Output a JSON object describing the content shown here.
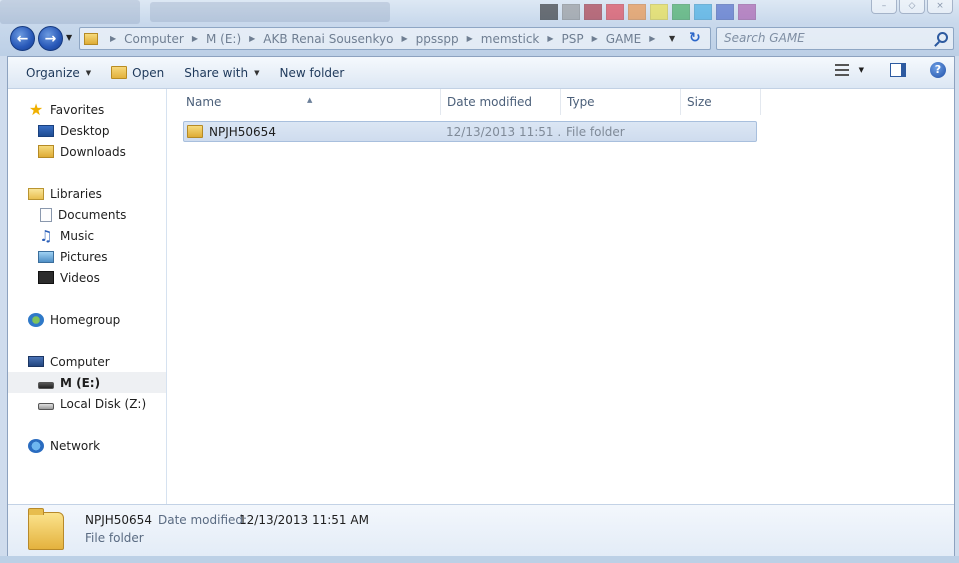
{
  "window": {
    "controls": [
      "–",
      "◇",
      "×"
    ]
  },
  "address": {
    "crumbs": [
      "Computer",
      "M (E:)",
      "AKB Renai Sousenkyo",
      "ppsspp",
      "memstick",
      "PSP",
      "GAME"
    ]
  },
  "search": {
    "placeholder": "Search GAME"
  },
  "toolbar": {
    "organize": "Organize",
    "open": "Open",
    "share_with": "Share with",
    "new_folder": "New folder"
  },
  "navpane": {
    "favorites": "Favorites",
    "desktop": "Desktop",
    "downloads": "Downloads",
    "libraries": "Libraries",
    "documents": "Documents",
    "music": "Music",
    "pictures": "Pictures",
    "videos": "Videos",
    "homegroup": "Homegroup",
    "computer": "Computer",
    "drive_m": "M (E:)",
    "local_disk": "Local Disk (Z:)",
    "network": "Network"
  },
  "columns": {
    "name": "Name",
    "date_modified": "Date modified",
    "type": "Type",
    "size": "Size"
  },
  "files": [
    {
      "name": "NPJH50654",
      "date_modified": "12/13/2013 11:51 ...",
      "type": "File folder",
      "size": ""
    }
  ],
  "details": {
    "name": "NPJH50654",
    "date_label": "Date modified:",
    "date_value": "12/13/2013 11:51 AM",
    "type": "File folder"
  }
}
